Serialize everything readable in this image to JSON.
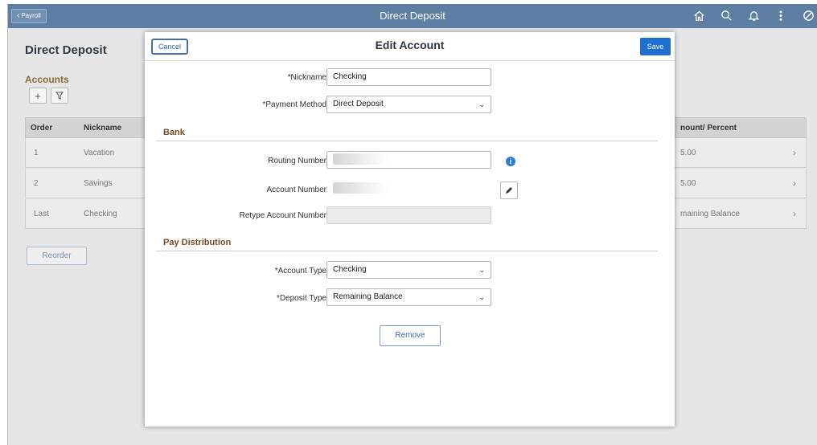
{
  "topbar": {
    "back_label": "Payroll",
    "title": "Direct Deposit",
    "icons": [
      "home-icon",
      "search-icon",
      "bell-icon",
      "more-icon",
      "cancel-icon"
    ]
  },
  "page": {
    "title": "Direct Deposit",
    "accounts_title": "Accounts",
    "reorder_label": "Reorder"
  },
  "grid": {
    "headers": {
      "order": "Order",
      "nickname": "Nickname",
      "amount": "nount/ Percent"
    },
    "rows": [
      {
        "order": "1",
        "nickname": "Vacation",
        "amount": "5.00"
      },
      {
        "order": "2",
        "nickname": "Savings",
        "amount": "5.00"
      },
      {
        "order": "Last",
        "nickname": "Checking",
        "amount": "maining Balance"
      }
    ]
  },
  "modal": {
    "cancel_label": "Cancel",
    "title": "Edit Account",
    "save_label": "Save",
    "nickname_label": "*Nickname",
    "nickname_value": "Checking",
    "payment_method_label": "*Payment Method",
    "payment_method_value": "Direct Deposit",
    "bank_section": "Bank",
    "routing_label": "Routing Number",
    "account_label": "Account Number",
    "retype_label": "Retype Account Number",
    "pay_section": "Pay Distribution",
    "account_type_label": "*Account Type",
    "account_type_value": "Checking",
    "deposit_type_label": "*Deposit Type",
    "deposit_type_value": "Remaining Balance",
    "remove_label": "Remove"
  },
  "colors": {
    "topbar": "#5e7fa3",
    "save_button": "#1f6fd0",
    "section_heading": "#7a4b2a",
    "info_icon": "#2a7bd6"
  }
}
